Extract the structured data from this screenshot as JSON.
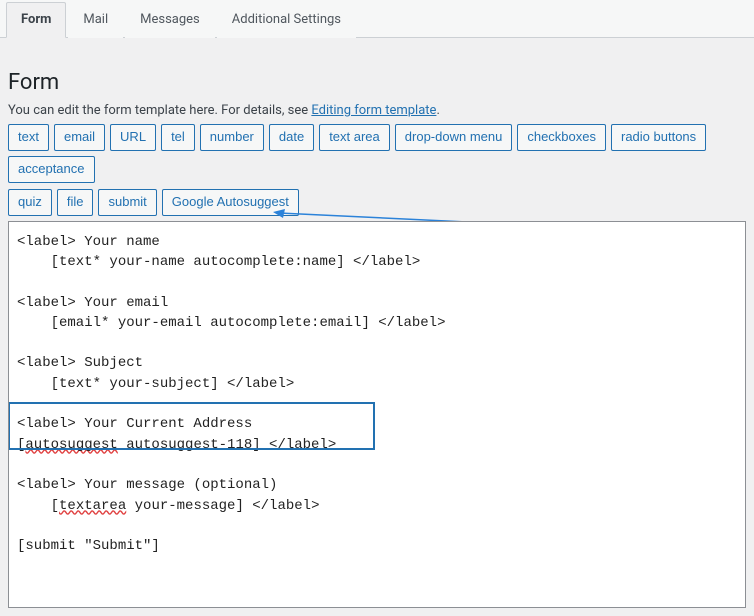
{
  "tabs": [
    {
      "label": "Form",
      "active": true
    },
    {
      "label": "Mail",
      "active": false
    },
    {
      "label": "Messages",
      "active": false
    },
    {
      "label": "Additional Settings",
      "active": false
    }
  ],
  "panel": {
    "heading": "Form",
    "desc_before": "You can edit the form template here. For details, see ",
    "desc_link": "Editing form template",
    "desc_after": "."
  },
  "tag_buttons_row1": [
    "text",
    "email",
    "URL",
    "tel",
    "number",
    "date",
    "text area",
    "drop-down menu",
    "checkboxes",
    "radio buttons",
    "acceptance"
  ],
  "tag_buttons_row2": [
    "quiz",
    "file",
    "submit",
    "Google Autosuggest"
  ],
  "editor": {
    "l1": "<label> Your name",
    "l2": "    [text* your-name autocomplete:name] </label>",
    "l3": "",
    "l4": "<label> Your email",
    "l5": "    [email* your-email autocomplete:email] </label>",
    "l6": "",
    "l7": "<label> Subject",
    "l8": "    [text* your-subject] </label>",
    "l9": "",
    "l10_a": "<label> Your Current Address",
    "l11_a": "[",
    "l11_b": "autosuggest",
    "l11_c": " autosuggest-118] </label>",
    "l12": "",
    "l13": "<label> Your message (optional)",
    "l14_a": "    [",
    "l14_b": "textarea",
    "l14_c": " your-message] </label>",
    "l15": "",
    "l16": "[submit \"Submit\"]"
  }
}
